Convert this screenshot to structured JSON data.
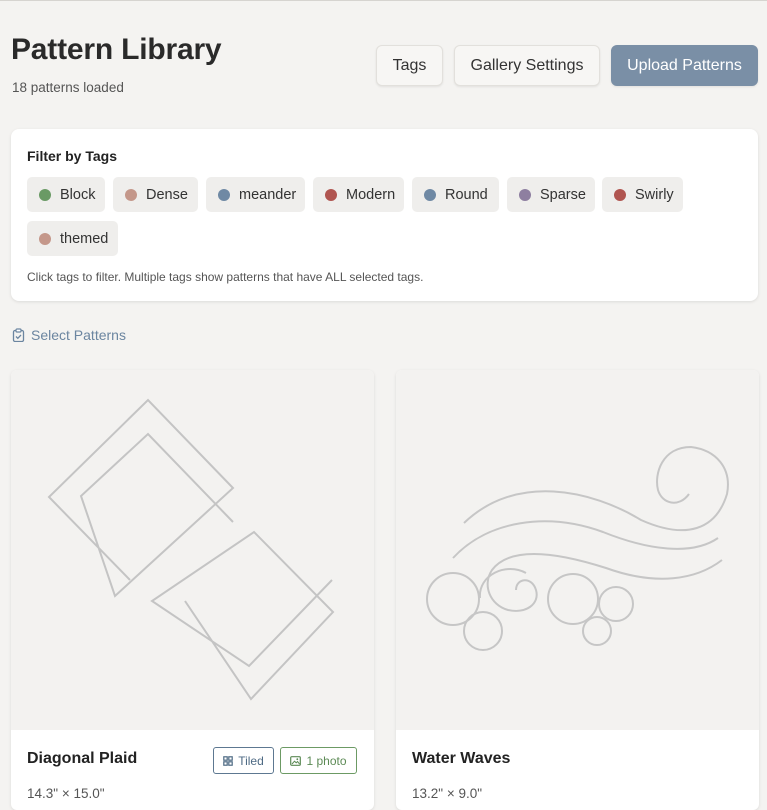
{
  "header": {
    "title": "Pattern Library",
    "subtitle": "18 patterns loaded",
    "buttons": {
      "tags": "Tags",
      "gallery_settings": "Gallery Settings",
      "upload": "Upload Patterns"
    }
  },
  "filter": {
    "title": "Filter by Tags",
    "hint": "Click tags to filter. Multiple tags show patterns that have ALL selected tags.",
    "tags": [
      {
        "label": "Block",
        "color": "#6a9a65"
      },
      {
        "label": "Dense",
        "color": "#c4978a"
      },
      {
        "label": "meander",
        "color": "#6f89a4"
      },
      {
        "label": "Modern",
        "color": "#b05550"
      },
      {
        "label": "Round",
        "color": "#6f89a4"
      },
      {
        "label": "Sparse",
        "color": "#8e7fa0"
      },
      {
        "label": "Swirly",
        "color": "#b05550"
      },
      {
        "label": "themed",
        "color": "#c4978a"
      }
    ]
  },
  "select_patterns": {
    "label": "Select Patterns",
    "icon": "clipboard-check-icon"
  },
  "patterns": [
    {
      "name": "Diagonal Plaid",
      "dimensions": "14.3\" × 15.0\"",
      "badges": [
        {
          "label": "Tiled",
          "icon": "grid-icon"
        },
        {
          "label": "1 photo",
          "icon": "image-icon"
        }
      ]
    },
    {
      "name": "Water Waves",
      "dimensions": "13.2\" × 9.0\"",
      "badges": []
    }
  ],
  "colors": {
    "accent": "#7a8fa6",
    "link": "#6b85a0",
    "tiled_badge": "#5d7891",
    "photo_badge": "#6c9a64"
  }
}
